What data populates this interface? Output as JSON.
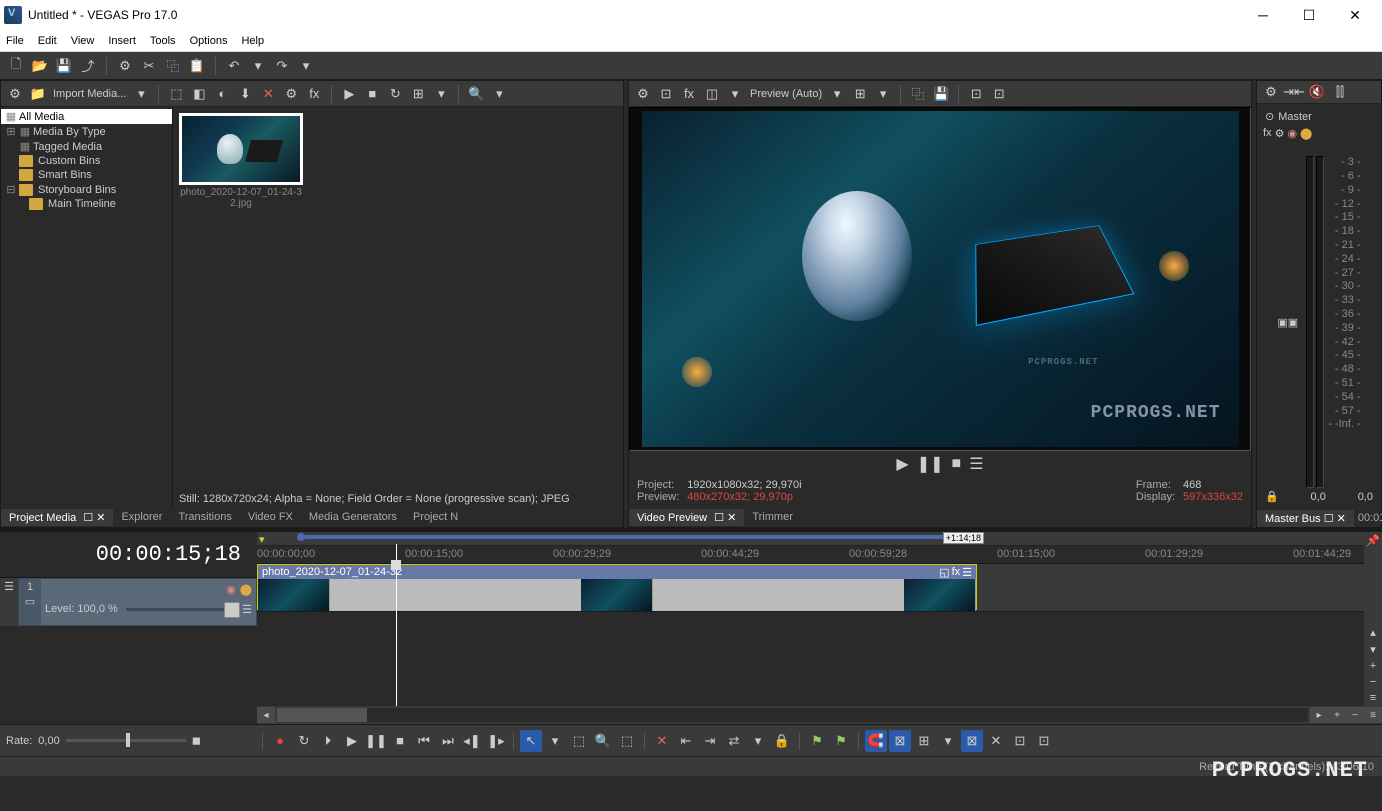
{
  "title": "Untitled * - VEGAS Pro 17.0",
  "menus": [
    "File",
    "Edit",
    "View",
    "Insert",
    "Tools",
    "Options",
    "Help"
  ],
  "media_tree": {
    "all_media": "All Media",
    "by_type": "Media By Type",
    "tagged": "Tagged Media",
    "custom": "Custom Bins",
    "smart": "Smart Bins",
    "storyboard": "Storyboard Bins",
    "main_tl": "Main Timeline"
  },
  "import_btn": "Import Media...",
  "thumb_name": "photo_2020-12-07_01-24-32.jpg",
  "media_status": "Still: 1280x720x24; Alpha = None; Field Order = None (progressive scan); JPEG",
  "left_tabs": [
    "Project Media",
    "Explorer",
    "Transitions",
    "Video FX",
    "Media Generators",
    "Project N"
  ],
  "preview_toolbar_label": "Preview (Auto)",
  "preview_info": {
    "project_lbl": "Project:",
    "project_val": "1920x1080x32; 29,970i",
    "preview_lbl": "Preview:",
    "preview_val": "480x270x32; 29,970p",
    "frame_lbl": "Frame:",
    "frame_val": "468",
    "display_lbl": "Display:",
    "display_val": "597x336x32"
  },
  "preview_tabs": [
    "Video Preview",
    "Trimmer"
  ],
  "master_label": "Master",
  "meter_scale": [
    "3",
    "6",
    "9",
    "12",
    "15",
    "18",
    "21",
    "24",
    "27",
    "30",
    "33",
    "36",
    "39",
    "42",
    "45",
    "48",
    "51",
    "54",
    "57",
    "-Inf."
  ],
  "master_reading": "0,0",
  "master_tabs": [
    "Master Bus"
  ],
  "master_time": "00:01",
  "timecode": "00:00:15;18",
  "track_level": "Level: 100,0 %",
  "track_num": "1",
  "ruler": [
    "00:00:00;00",
    "00:00:15;00",
    "00:00:29;29",
    "00:00:44;29",
    "00:00:59;28",
    "00:01:15;00",
    "00:01:29;29",
    "00:01:44;29"
  ],
  "region_time": "+1:14;18",
  "clip_name": "photo_2020-12-07_01-24-32",
  "rate_lbl": "Rate:",
  "rate_val": "0,00",
  "status_text": "Record Time (2 channels): 43:06:10",
  "watermark": "PCPROGS.NET"
}
